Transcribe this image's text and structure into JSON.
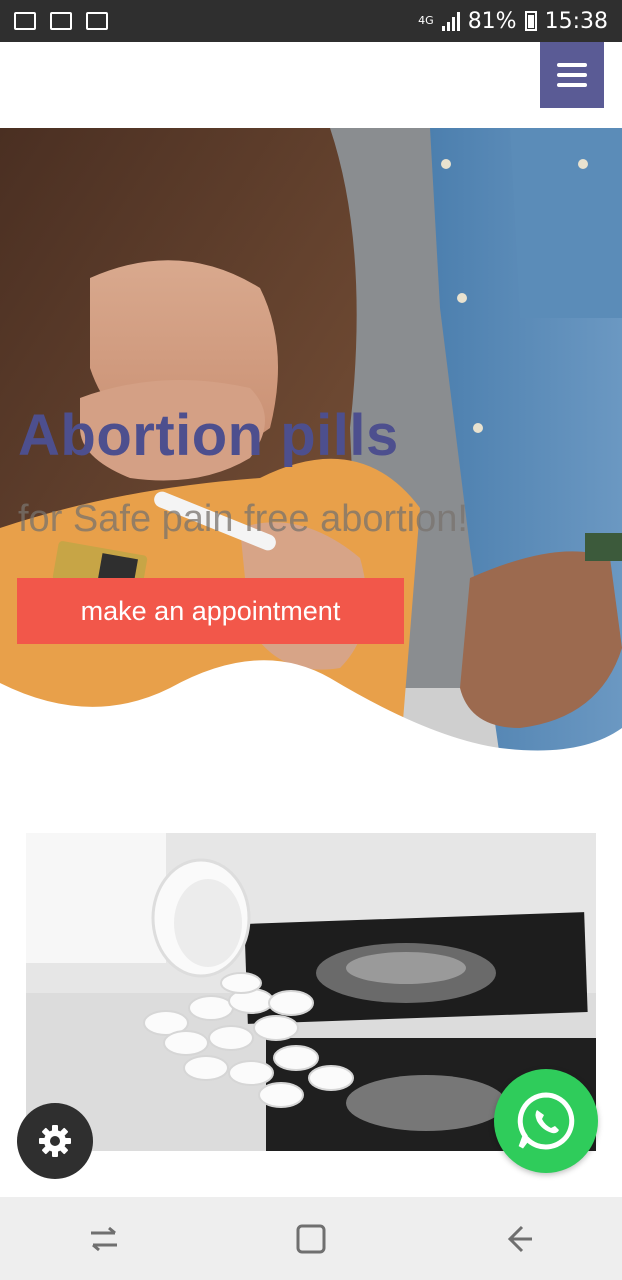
{
  "status_bar": {
    "network": "4G",
    "battery": "81%",
    "time": "15:38",
    "icons": [
      "gallery-notification-icon",
      "checklist-notification-icon",
      "image-notification-icon"
    ]
  },
  "header": {
    "menu_icon": "hamburger-menu-icon"
  },
  "hero": {
    "title": "Abortion pills",
    "subtitle": "for Safe pain free abortion!",
    "cta_label": "make an appointment",
    "title_color": "#4d4f8e",
    "cta_color": "#f2574a"
  },
  "floating": {
    "settings_icon": "gear-icon",
    "whatsapp_icon": "whatsapp-icon",
    "whatsapp_color": "#2fcc5b"
  },
  "navbar": {
    "icons": [
      "recent-apps-icon",
      "home-icon",
      "back-icon"
    ]
  }
}
